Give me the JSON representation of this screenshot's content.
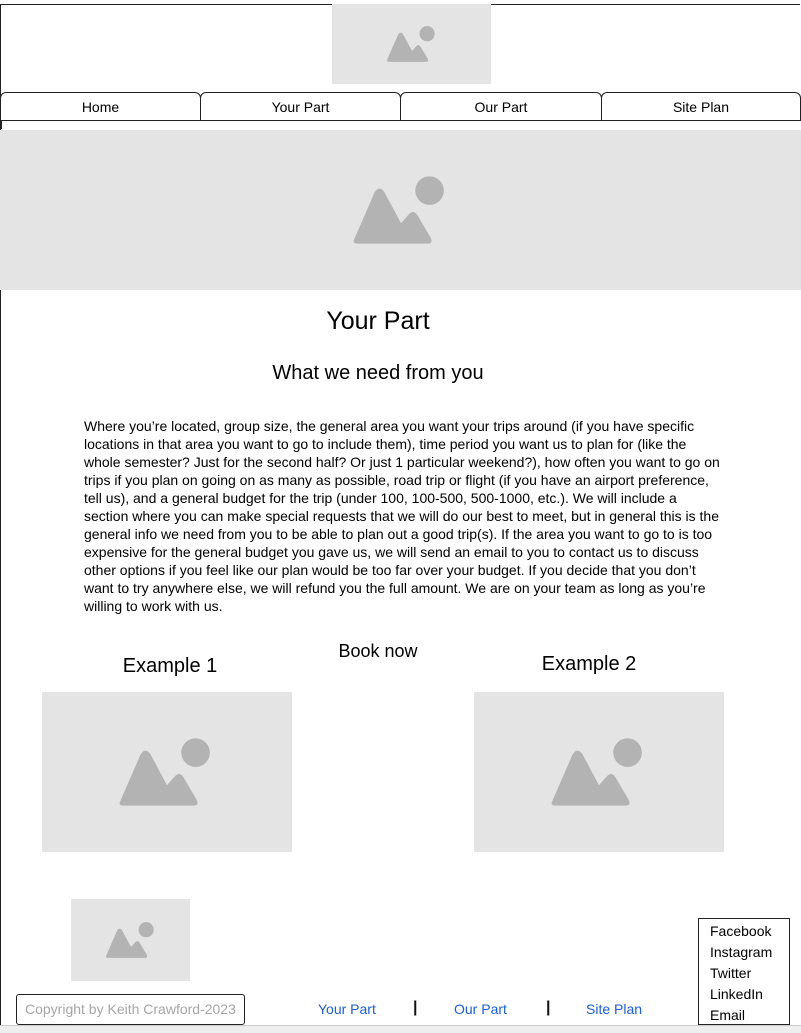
{
  "colors": {
    "placeholder": "#e4e4e4",
    "placeholder_icon": "#b3b3b3",
    "link": "#1a5fd6",
    "copyright_text": "#a6a6a6"
  },
  "nav": {
    "tabs": [
      {
        "label": "Home"
      },
      {
        "label": "Your Part"
      },
      {
        "label": "Our Part"
      },
      {
        "label": "Site Plan"
      }
    ]
  },
  "main": {
    "title": "Your Part",
    "subtitle": "What we need from you",
    "body": "Where you’re located, group size, the general area you want your trips around (if you have specific locations in that area you want to go to include them), time period you want us to plan for (like the whole semester? Just for the second half? Or just 1 particular weekend?), how often you want to go on trips if you plan on going on as many as possible, road trip or flight (if you have an airport preference, tell us), and a general budget for the trip (under 100, 100-500, 500-1000, etc.). We will include a section where you can make special requests that we will do our best to meet, but in general this is the general info we need from you to be able to plan out a good trip(s). If the area you want to go to is too expensive for the general budget you gave us, we will send an email to you to contact us to discuss other options if you feel like our plan would be too far over your budget. If you decide that you don’t want to try anywhere else, we will refund you the full amount. We are on your team as long as you’re willing to work with us.",
    "book_now": "Book now",
    "example1": "Example 1",
    "example2": "Example 2"
  },
  "footer": {
    "copyright": "Copyright by Keith Crawford-2023",
    "links": [
      {
        "label": "Your Part"
      },
      {
        "label": "Our Part"
      },
      {
        "label": "Site Plan"
      }
    ],
    "separator": "|",
    "social": [
      {
        "label": "Facebook"
      },
      {
        "label": "Instagram"
      },
      {
        "label": "Twitter"
      },
      {
        "label": "LinkedIn"
      },
      {
        "label": "Email"
      }
    ]
  },
  "icons": {
    "image_placeholder": "image-placeholder-icon"
  }
}
